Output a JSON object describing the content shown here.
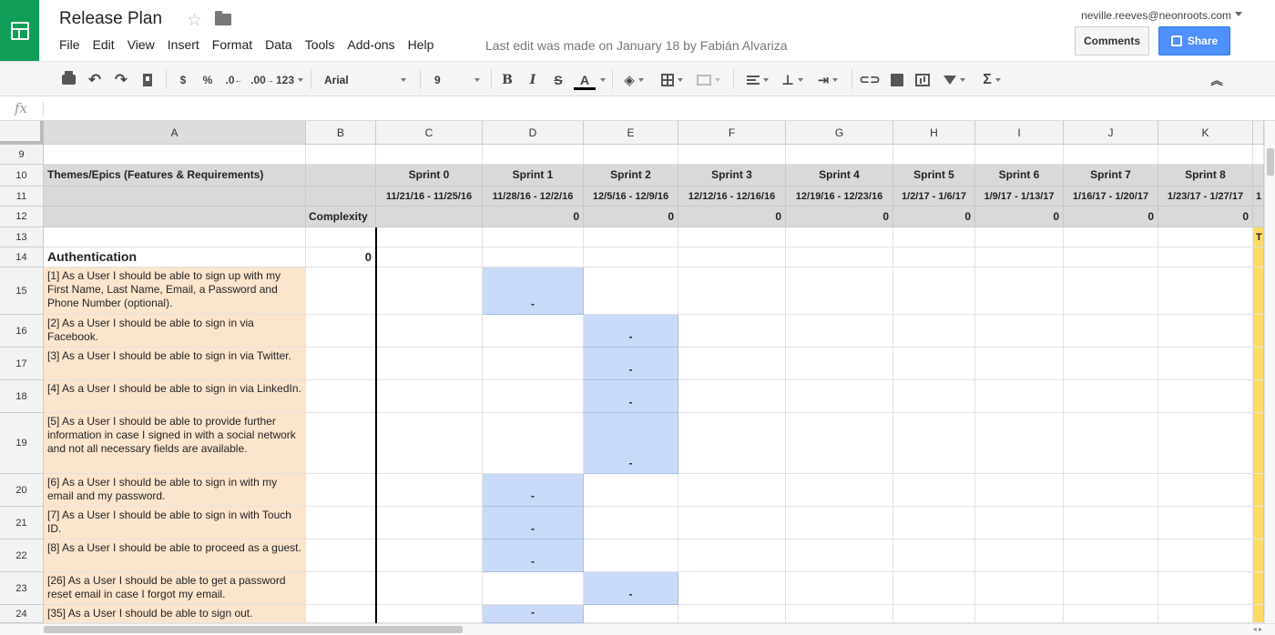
{
  "app": {
    "title": "Release Plan",
    "menus": [
      "File",
      "Edit",
      "View",
      "Insert",
      "Format",
      "Data",
      "Tools",
      "Add-ons",
      "Help"
    ],
    "last_edit": "Last edit was made on January 18 by Fabián Alvariza",
    "user_email": "neville.reeves@neonroots.com",
    "comments_label": "Comments",
    "share_label": "Share"
  },
  "toolbar": {
    "currency": "$",
    "percent": "%",
    "decrease_decimals": ".0",
    "increase_decimals": ".00",
    "more_formats": "123",
    "font": "Arial",
    "font_size": "9",
    "bold": "B",
    "italic": "I",
    "strikethrough": "S",
    "text_color": "A",
    "sigma": "Σ"
  },
  "formula_bar": {
    "value": ""
  },
  "columns": [
    "A",
    "B",
    "C",
    "D",
    "E",
    "F",
    "G",
    "H",
    "I",
    "J",
    "K"
  ],
  "rows": [
    {
      "num": "9",
      "kind": "blank"
    },
    {
      "num": "10",
      "kind": "sprint-header",
      "a": "Themes/Epics (Features & Requirements)",
      "sprints": [
        "Sprint 0",
        "Sprint 1",
        "Sprint 2",
        "Sprint 3",
        "Sprint 4",
        "Sprint 5",
        "Sprint 6",
        "Sprint 7",
        "Sprint 8"
      ]
    },
    {
      "num": "11",
      "kind": "dates",
      "dates": [
        "11/21/16 - 11/25/16",
        "11/28/16 - 12/2/16",
        "12/5/16 - 12/9/16",
        "12/12/16 - 12/16/16",
        "12/19/16 - 12/23/16",
        "1/2/17 - 1/6/17",
        "1/9/17 - 1/13/17",
        "1/16/17 - 1/20/17",
        "1/23/17 - 1/27/17"
      ],
      "overflow": "1"
    },
    {
      "num": "12",
      "kind": "complexity",
      "b": "Complexity",
      "totals": [
        "",
        "0",
        "0",
        "0",
        "0",
        "0",
        "0",
        "0",
        "0"
      ]
    },
    {
      "num": "13",
      "kind": "blank",
      "overflow": "T"
    },
    {
      "num": "14",
      "kind": "section",
      "a": "Authentication",
      "b": "0"
    },
    {
      "num": "15",
      "kind": "story",
      "a": "[1] As a User I should be able to sign up with my First Name, Last Name, Email, a Password and Phone Number (optional).",
      "sprint": "D",
      "mark": "-"
    },
    {
      "num": "16",
      "kind": "story",
      "a": "[2] As a User I should be able to sign in via Facebook.",
      "sprint": "E",
      "mark": "-"
    },
    {
      "num": "17",
      "kind": "story",
      "a": "[3] As a User I should be able to sign in via Twitter.",
      "sprint": "E",
      "mark": "-"
    },
    {
      "num": "18",
      "kind": "story",
      "a": "[4] As a User I should be able to sign in via LinkedIn.",
      "sprint": "E",
      "mark": "-"
    },
    {
      "num": "19",
      "kind": "story",
      "a": "[5] As a User I should be able to provide further information in case I signed in with a social network and not all necessary fields are available.",
      "sprint": "E",
      "mark": "-"
    },
    {
      "num": "20",
      "kind": "story",
      "a": "[6] As a User I should be able to sign in with my email and my password.",
      "sprint": "D",
      "mark": "-"
    },
    {
      "num": "21",
      "kind": "story",
      "a": "[7] As a User I should be able to sign in with Touch ID.",
      "sprint": "D",
      "mark": "-"
    },
    {
      "num": "22",
      "kind": "story",
      "a": "[8] As a User I should be able to proceed as a guest.",
      "sprint": "D",
      "mark": "-"
    },
    {
      "num": "23",
      "kind": "story",
      "a": "[26] As a User I should be able to get a password reset email in case I forgot my email.",
      "sprint": "E",
      "mark": "-"
    },
    {
      "num": "24",
      "kind": "story",
      "a": "[35] As a User I should be able to sign out.",
      "sprint": "D",
      "mark": "-"
    }
  ]
}
